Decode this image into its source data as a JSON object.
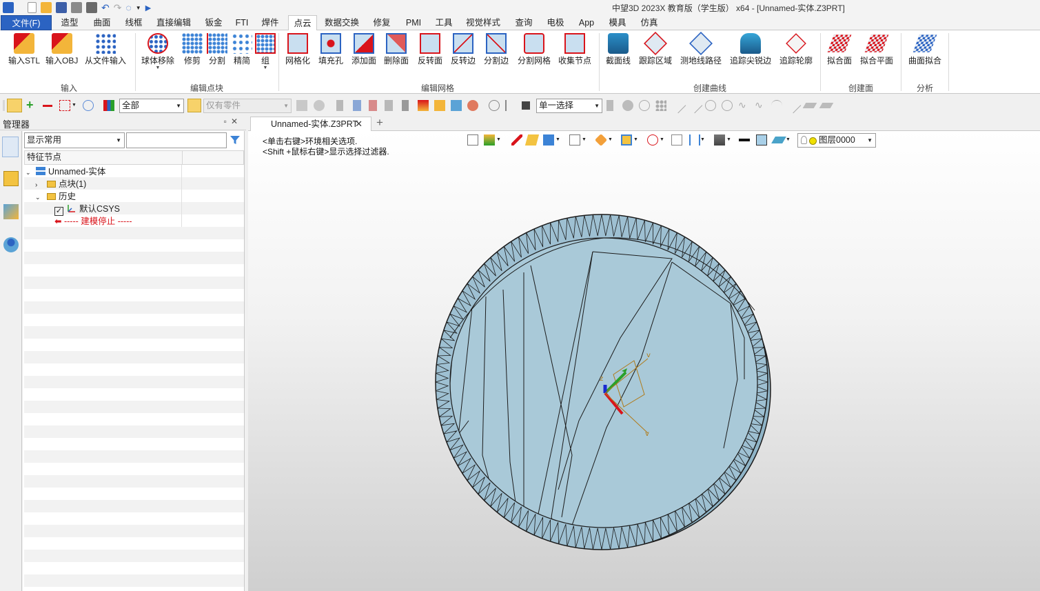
{
  "window": {
    "title": "中望3D  2023X 教育版（学生版）  x64 - [Unnamed-实体.Z3PRT]"
  },
  "menu": {
    "file": "文件(F)",
    "tabs": [
      "造型",
      "曲面",
      "线框",
      "直接编辑",
      "钣金",
      "FTI",
      "焊件",
      "点云",
      "数据交换",
      "修复",
      "PMI",
      "工具",
      "视觉样式",
      "查询",
      "电极",
      "App",
      "模具",
      "仿真"
    ],
    "active_tab": "点云"
  },
  "ribbon": {
    "buttons": [
      "输入STL",
      "输入OBJ",
      "从文件输入",
      "球体移除",
      "修剪",
      "分割",
      "精简",
      "组",
      "网格化",
      "填充孔",
      "添加面",
      "删除面",
      "反转面",
      "反转边",
      "分割边",
      "分割网格",
      "收集节点",
      "截面线",
      "跟踪区域",
      "测地线路径",
      "追踪尖锐边",
      "追踪轮廓",
      "拟合面",
      "拟合平面",
      "曲面拟合"
    ],
    "groups": [
      "输入",
      "编辑点块",
      "编辑网格",
      "创建曲线",
      "创建面",
      "分析"
    ]
  },
  "toolbar": {
    "filter_value": "全部",
    "part_filter_value": "仅有零件",
    "select_mode_value": "单一选择"
  },
  "manager": {
    "title": "管理器",
    "filter_combo": "显示常用",
    "search_placeholder": "",
    "column_header": "特征节点",
    "tree": {
      "root": "Unnamed-实体",
      "pointblock": "点块(1)",
      "history": "历史",
      "csys": "默认CSYS",
      "stop": "----- 建模停止 -----"
    }
  },
  "document": {
    "tab_label": "Unnamed-实体.Z3PRT",
    "add_tab": "+"
  },
  "viewport": {
    "hint_line1": "<单击右键>环境相关选项.",
    "hint_line2": "<Shift +鼠标右键>显示选择过滤器.",
    "layer_value": "图层0000"
  },
  "colors": {
    "accent": "#2b63c2",
    "mesh_fill": "#a9c9d8",
    "mesh_rim": "#8fb4c7",
    "mesh_edge": "#1a1a1a",
    "stop_marker": "#d9141b"
  },
  "icons": {
    "csys_axes": [
      "x-axis-red",
      "y-axis-green",
      "z-axis-blue"
    ]
  }
}
